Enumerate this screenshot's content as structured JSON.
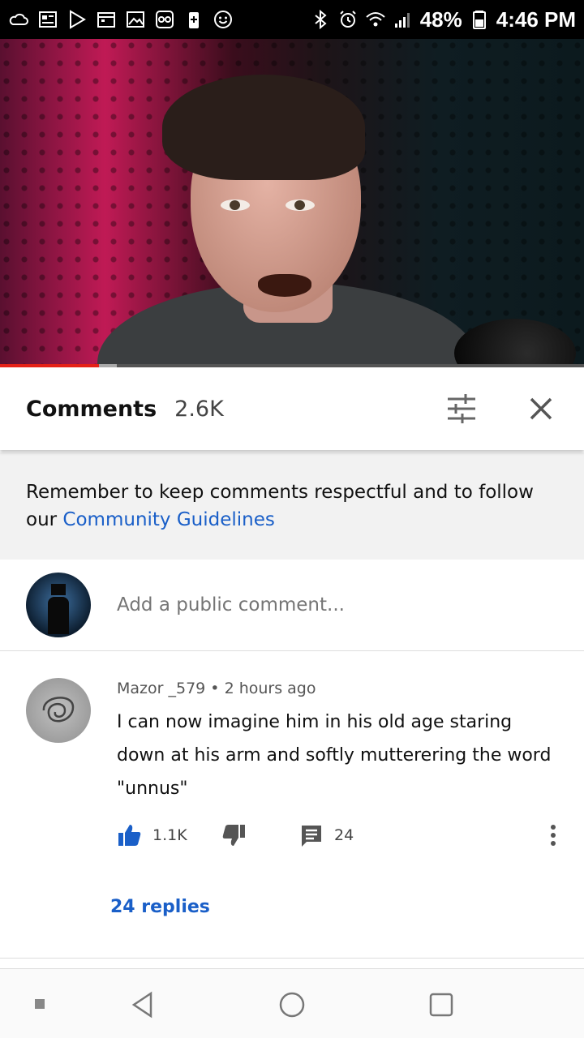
{
  "status_bar": {
    "battery": "48%",
    "time": "4:46 PM",
    "left_icons": [
      "cloud-icon",
      "news-icon",
      "play-store-icon",
      "calendar-icon",
      "gallery-icon",
      "voicemail-icon",
      "battery-saver-icon",
      "smiley-icon"
    ],
    "right_icons": [
      "bluetooth-icon",
      "alarm-icon",
      "wifi-icon",
      "signal-icon",
      "battery-icon"
    ]
  },
  "video": {
    "progress": 0.17,
    "buffered": 0.2
  },
  "header": {
    "title": "Comments",
    "count": "2.6K",
    "sort_icon": "sort-filter-icon",
    "close_icon": "close-icon"
  },
  "guidelines": {
    "text": "Remember to keep comments respectful and to follow our ",
    "link": "Community Guidelines"
  },
  "add_comment": {
    "placeholder": "Add a public comment..."
  },
  "comment": {
    "author": "Mazor _579",
    "separator": "•",
    "time": "2 hours ago",
    "text": "I can now imagine him in his old age staring down at his arm and softly mutterering the word \"unnus\"",
    "likes": "1.1K",
    "reply_count": "24",
    "replies_link": "24 replies"
  },
  "colors": {
    "accent": "#1a5fc8",
    "progress": "#e62117"
  }
}
